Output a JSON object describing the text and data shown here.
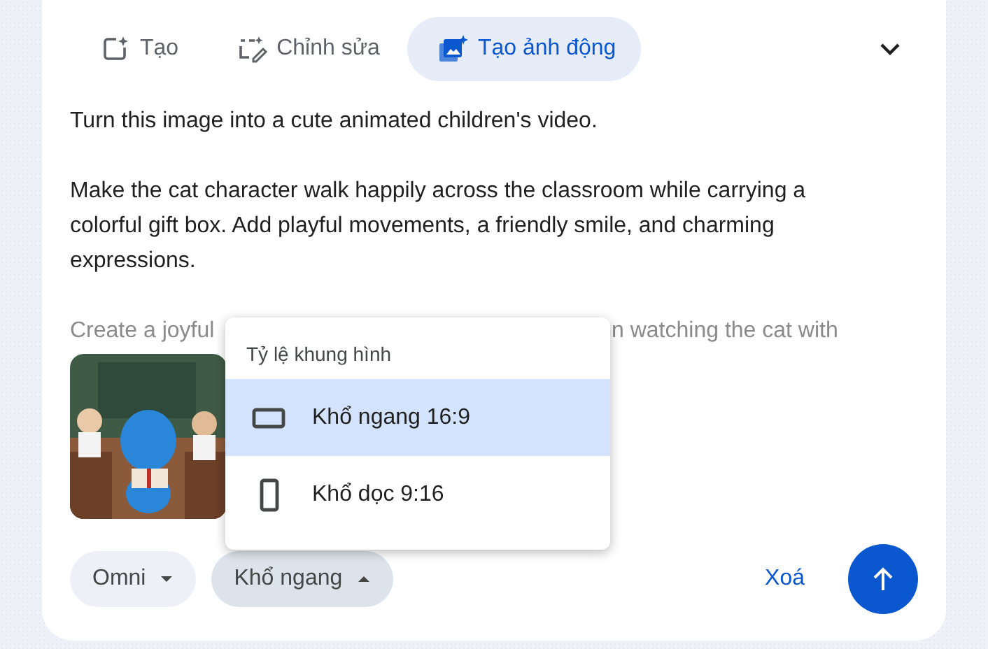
{
  "tabs": [
    {
      "label": "Tạo",
      "selected": false
    },
    {
      "label": "Chỉnh sửa",
      "selected": false
    },
    {
      "label": "Tạo ảnh động",
      "selected": true
    }
  ],
  "prompt": {
    "paragraphs": [
      "Turn this image into a cute animated children's video.",
      "Make the cat character walk happily across the classroom while carrying a colorful gift box. Add playful movements, a friendly smile, and charming expressions.",
      "Create a joyful"
    ],
    "visible_tail": "n watching the cat with"
  },
  "menu": {
    "title": "Tỷ lệ khung hình",
    "items": [
      {
        "label": "Khổ ngang 16:9",
        "kind": "landscape",
        "selected": true
      },
      {
        "label": "Khổ dọc 9:16",
        "kind": "portrait",
        "selected": false
      }
    ]
  },
  "toolbar": {
    "model": "Omni",
    "aspect": "Khổ ngang",
    "aspect_expanded": true,
    "clear": "Xoá"
  }
}
